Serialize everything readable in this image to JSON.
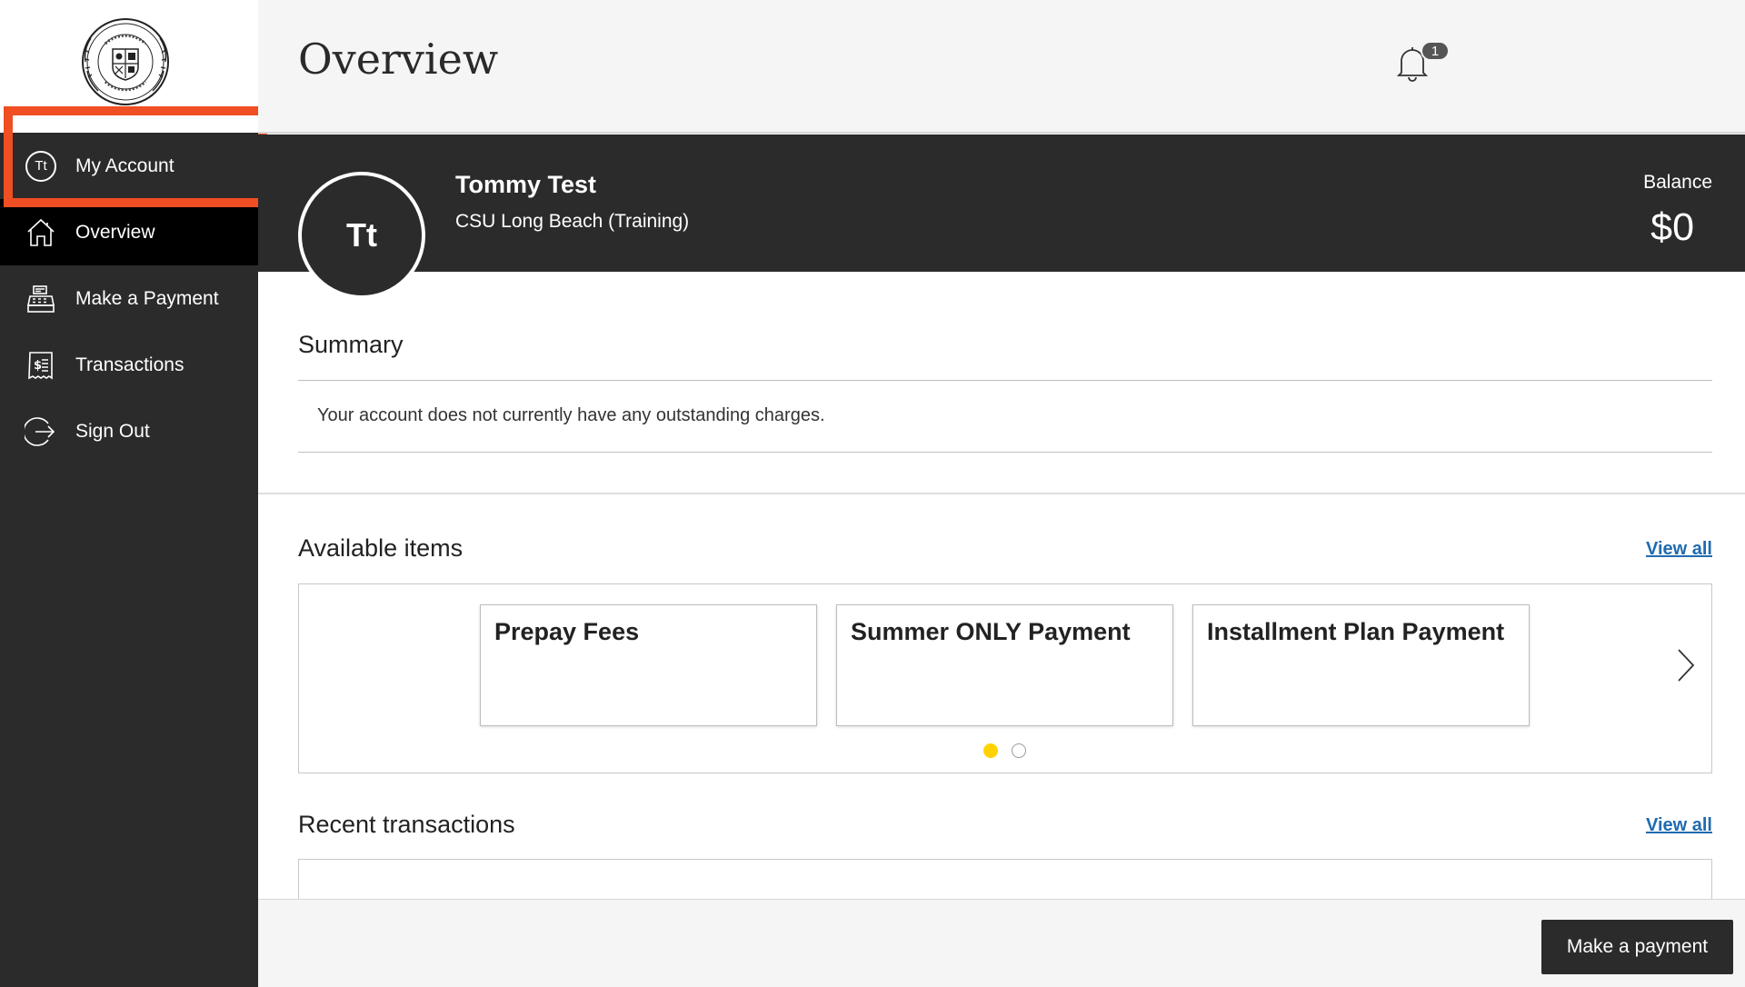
{
  "sidebar": {
    "account_label": "My Account",
    "account_initials": "Tt",
    "items": [
      {
        "label": "Overview",
        "icon": "home-icon",
        "active": true
      },
      {
        "label": "Make a Payment",
        "icon": "cash-register-icon",
        "active": false
      },
      {
        "label": "Transactions",
        "icon": "receipt-dollar-icon",
        "active": false
      },
      {
        "label": "Sign Out",
        "icon": "sign-out-icon",
        "active": false
      }
    ]
  },
  "header": {
    "title": "Overview",
    "notification_count": "1"
  },
  "profile": {
    "initials": "Tt",
    "name": "Tommy Test",
    "school": "CSU Long Beach (Training)",
    "balance_label": "Balance",
    "balance_value": "$0"
  },
  "summary": {
    "title": "Summary",
    "message": "Your account does not currently have any outstanding charges."
  },
  "available_items": {
    "title": "Available items",
    "view_all": "View all",
    "cards": [
      "Prepay Fees",
      "Summer ONLY Payment",
      "Installment Plan Payment"
    ],
    "page_count": 2,
    "current_page": 1
  },
  "recent_transactions": {
    "title": "Recent transactions",
    "view_all": "View all"
  },
  "footer": {
    "pay_button": "Make a payment"
  },
  "colors": {
    "sidebar_bg": "#2b2b2b",
    "highlight": "#f04e23",
    "link": "#1f6bb0",
    "dot_active": "#ffd200"
  }
}
